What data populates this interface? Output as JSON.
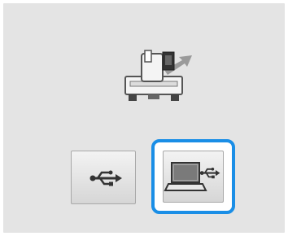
{
  "screen": {
    "machine_icon": "embroidery-machine-icon",
    "options": [
      {
        "icon": "usb-icon",
        "selected": false
      },
      {
        "icon": "computer-usb-icon",
        "selected": true
      }
    ],
    "colors": {
      "background": "#e4e4e4",
      "selection_highlight": "#1a8ee6"
    }
  }
}
